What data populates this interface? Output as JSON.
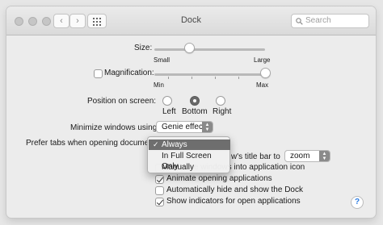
{
  "window": {
    "title": "Dock",
    "search_placeholder": "Search",
    "back_glyph": "‹",
    "forward_glyph": "›"
  },
  "size": {
    "label": "Size:",
    "min_label": "Small",
    "max_label": "Large",
    "value": 0.32
  },
  "magnification": {
    "label": "Magnification:",
    "checked": false,
    "min_label": "Min",
    "max_label": "Max",
    "value": 1.0
  },
  "position": {
    "label": "Position on screen:",
    "options": [
      "Left",
      "Bottom",
      "Right"
    ],
    "selected": "Bottom"
  },
  "minimize": {
    "label": "Minimize windows using:",
    "value": "Genie effect"
  },
  "prefer_tabs": {
    "label": "Prefer tabs when opening documents",
    "menu": {
      "options": [
        "Always",
        "In Full Screen Only",
        "Manually"
      ],
      "selected": "Always",
      "check_glyph": "✓"
    }
  },
  "double_click": {
    "label_visible": "w's title bar to",
    "value": "zoom"
  },
  "checkboxes": {
    "minimize_into_icon": {
      "label": "Minimize windows into application icon",
      "checked": false
    },
    "animate": {
      "label": "Animate opening applications",
      "checked": true
    },
    "autohide": {
      "label": "Automatically hide and show the Dock",
      "checked": false
    },
    "indicators": {
      "label": "Show indicators for open applications",
      "checked": true
    }
  },
  "help": {
    "label": "?"
  },
  "icons": [
    "close-light",
    "minimize-light",
    "zoom-light",
    "back-icon",
    "forward-icon",
    "grid-icon",
    "search-icon",
    "checkmark-icon",
    "help-icon"
  ]
}
